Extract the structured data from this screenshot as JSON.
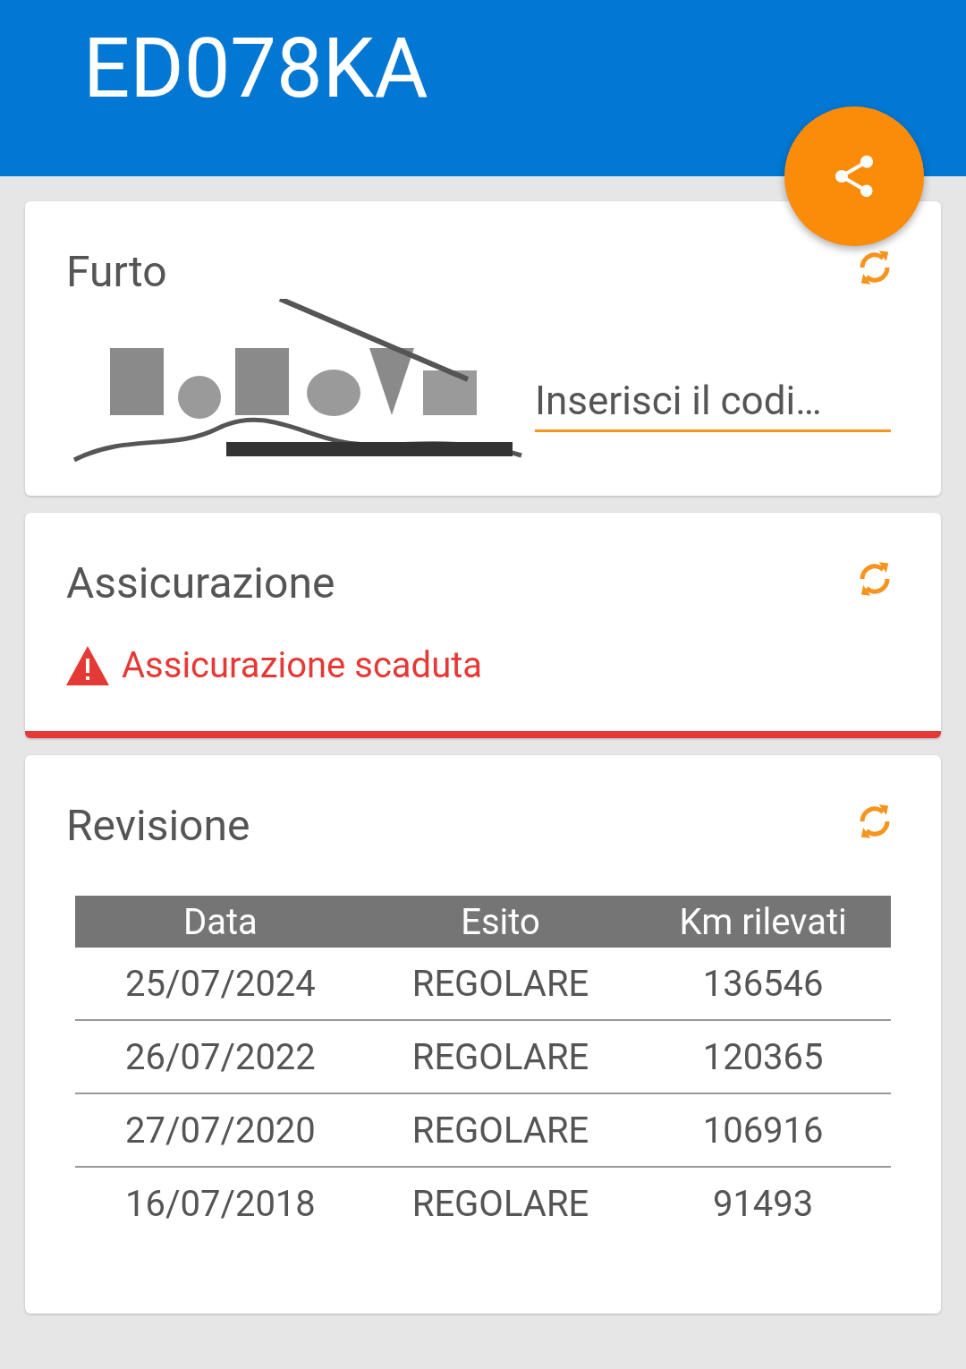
{
  "header": {
    "title": "ED078KA"
  },
  "theft": {
    "title": "Furto",
    "code_field": {
      "placeholder": "Inserisci il codi…"
    }
  },
  "insurance": {
    "title": "Assicurazione",
    "alert": {
      "kind": "warning",
      "text": "Assicurazione scaduta"
    }
  },
  "inspection": {
    "title": "Revisione",
    "table": {
      "columns": [
        "Data",
        "Esito",
        "Km rilevati"
      ],
      "rows": [
        [
          "25/07/2024",
          "REGOLARE",
          "136546"
        ],
        [
          "26/07/2022",
          "REGOLARE",
          "120365"
        ],
        [
          "27/07/2020",
          "REGOLARE",
          "106916"
        ],
        [
          "16/07/2018",
          "REGOLARE",
          "91493"
        ]
      ]
    }
  }
}
